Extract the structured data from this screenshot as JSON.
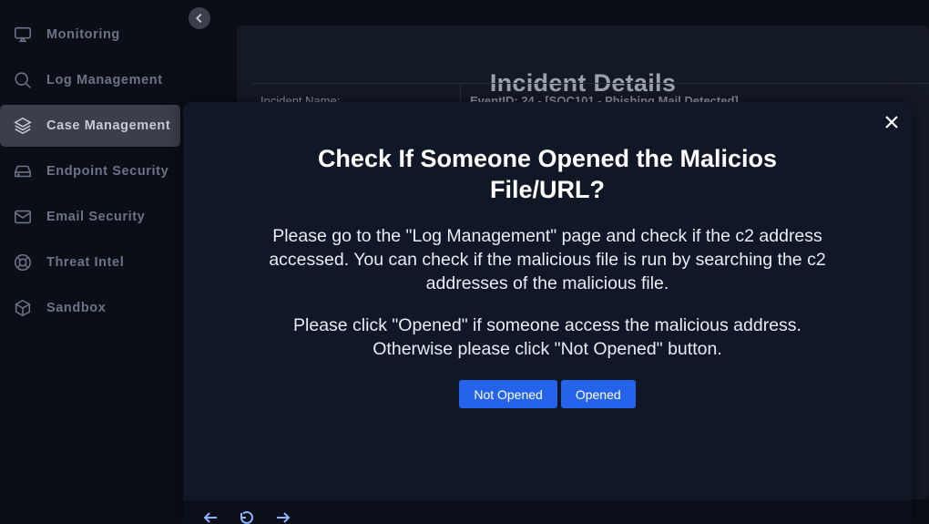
{
  "sidebar": {
    "items": [
      {
        "label": "Monitoring",
        "icon": "monitor-icon"
      },
      {
        "label": "Log Management",
        "icon": "search-icon"
      },
      {
        "label": "Case Management",
        "icon": "layers-icon",
        "active": true
      },
      {
        "label": "Endpoint Security",
        "icon": "hard-drive-icon"
      },
      {
        "label": "Email Security",
        "icon": "mail-icon"
      },
      {
        "label": "Threat Intel",
        "icon": "lifebuoy-icon"
      },
      {
        "label": "Sandbox",
        "icon": "cube-icon"
      }
    ]
  },
  "incident": {
    "title": "Incident Details",
    "rows": [
      {
        "key": "Incident Name:",
        "value": "EventID: 24 - [SOC101 - Phishing Mail Detected]"
      }
    ]
  },
  "modal": {
    "title": "Check If Someone Opened the Malicios File/URL?",
    "paragraph1": "Please go to the \"Log Management\" page and check if the c2 address accessed. You can check if the malicious file is run by searching the c2 addresses of the malicious file.",
    "paragraph2": "Please click \"Opened\" if someone access the malicious address. Otherwise please click \"Not Opened\" button.",
    "buttons": {
      "not_opened": "Not Opened",
      "opened": "Opened"
    }
  },
  "colors": {
    "background": "#0b0e17",
    "modal": "#101726",
    "accent": "#2563eb",
    "active_item": "#3a3f4b"
  }
}
